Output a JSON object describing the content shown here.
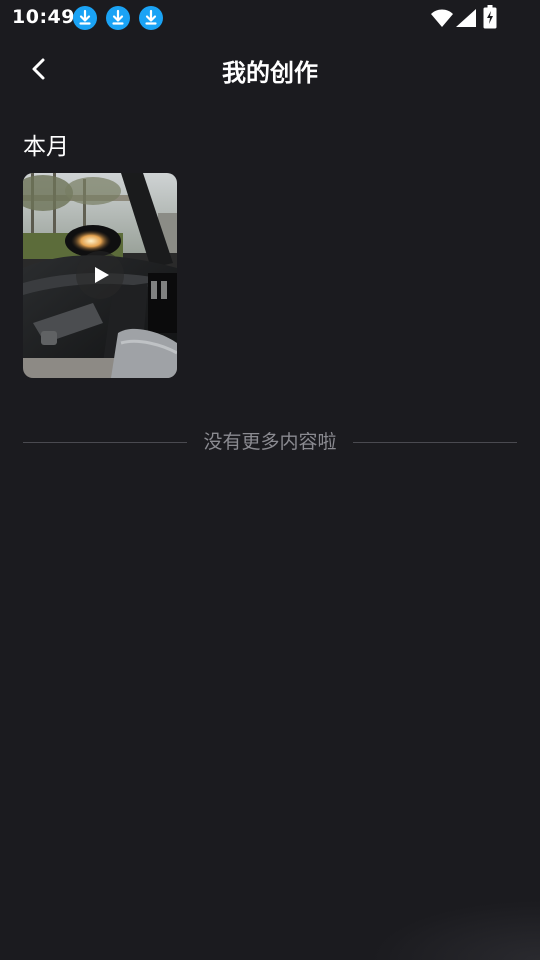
{
  "status_bar": {
    "time": "10:49",
    "notification_icons": [
      "download-icon",
      "download-icon",
      "download-icon"
    ],
    "right_icons": [
      "wifi-icon",
      "signal-icon",
      "battery-charging-icon"
    ],
    "accent_color": "#1aa3f5"
  },
  "header": {
    "title": "我的创作",
    "back_icon": "chevron-left-icon"
  },
  "section": {
    "title": "本月",
    "videos": [
      {
        "thumbnail": "car-interior-video-thumbnail",
        "icon": "play-icon"
      }
    ]
  },
  "footer": {
    "end_text": "没有更多内容啦"
  },
  "colors": {
    "background": "#1b1b1f",
    "text_primary": "#ffffff",
    "text_secondary": "#8a8a90",
    "divider": "#4a4a50"
  }
}
